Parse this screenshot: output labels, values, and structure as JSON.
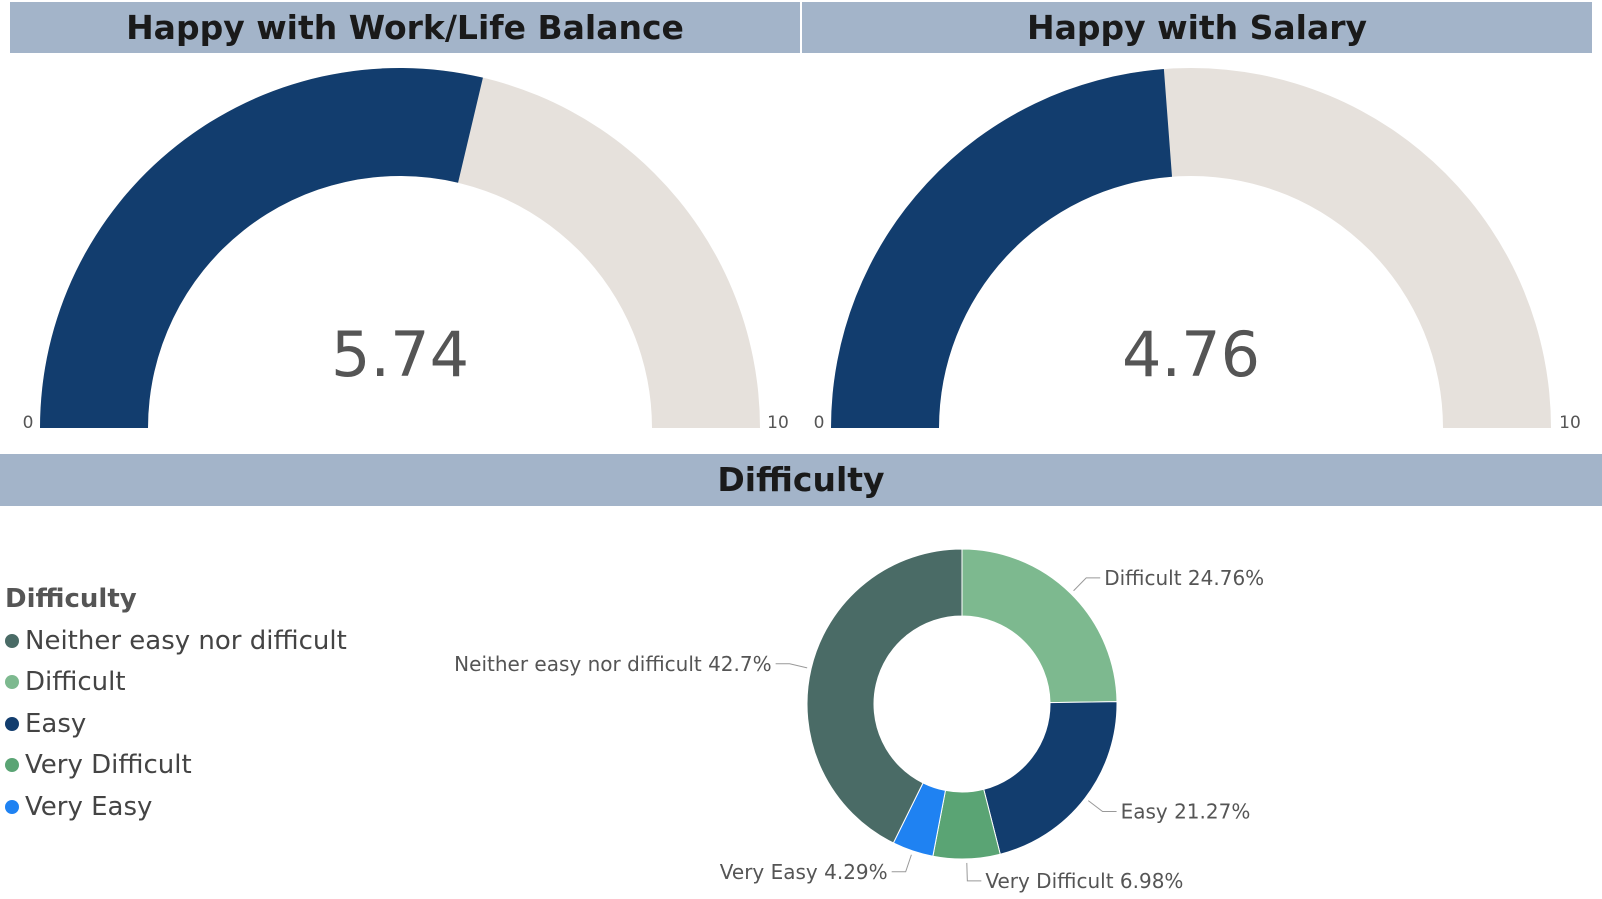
{
  "gauges": {
    "work_life": {
      "title": "Happy with Work/Life Balance",
      "value": 5.74,
      "value_label": "5.74",
      "min": 0,
      "max": 10,
      "min_label": "0",
      "max_label": "10"
    },
    "salary": {
      "title": "Happy with Salary",
      "value": 4.76,
      "value_label": "4.76",
      "min": 0,
      "max": 10,
      "min_label": "0",
      "max_label": "10"
    }
  },
  "difficulty": {
    "title": "Difficulty",
    "legend_title": "Difficulty",
    "legend": [
      {
        "label": "Neither easy nor difficult",
        "color": "#4a6b66"
      },
      {
        "label": "Difficult",
        "color": "#7db98f"
      },
      {
        "label": "Easy",
        "color": "#123d6e"
      },
      {
        "label": "Very Difficult",
        "color": "#5aa474"
      },
      {
        "label": "Very Easy",
        "color": "#1f82f2"
      }
    ]
  },
  "colors": {
    "gauge_fill": "#123d6e",
    "gauge_track": "#e6e1dc",
    "header_bg": "#a3b4c9"
  },
  "chart_data": [
    {
      "type": "gauge",
      "title": "Happy with Work/Life Balance",
      "value": 5.74,
      "min": 0,
      "max": 10
    },
    {
      "type": "gauge",
      "title": "Happy with Salary",
      "value": 4.76,
      "min": 0,
      "max": 10
    },
    {
      "type": "pie",
      "title": "Difficulty",
      "donut": true,
      "legend_position": "left",
      "slices": [
        {
          "label": "Difficult",
          "value": 24.76,
          "data_label": "Difficult 24.76%",
          "color": "#7db98f"
        },
        {
          "label": "Easy",
          "value": 21.27,
          "data_label": "Easy 21.27%",
          "color": "#123d6e"
        },
        {
          "label": "Very Difficult",
          "value": 6.98,
          "data_label": "Very Difficult 6.98%",
          "color": "#5aa474"
        },
        {
          "label": "Very Easy",
          "value": 4.29,
          "data_label": "Very Easy 4.29%",
          "color": "#1f82f2"
        },
        {
          "label": "Neither easy nor difficult",
          "value": 42.7,
          "data_label": "Neither easy nor difficult 42.7%",
          "color": "#4a6b66"
        }
      ]
    }
  ]
}
